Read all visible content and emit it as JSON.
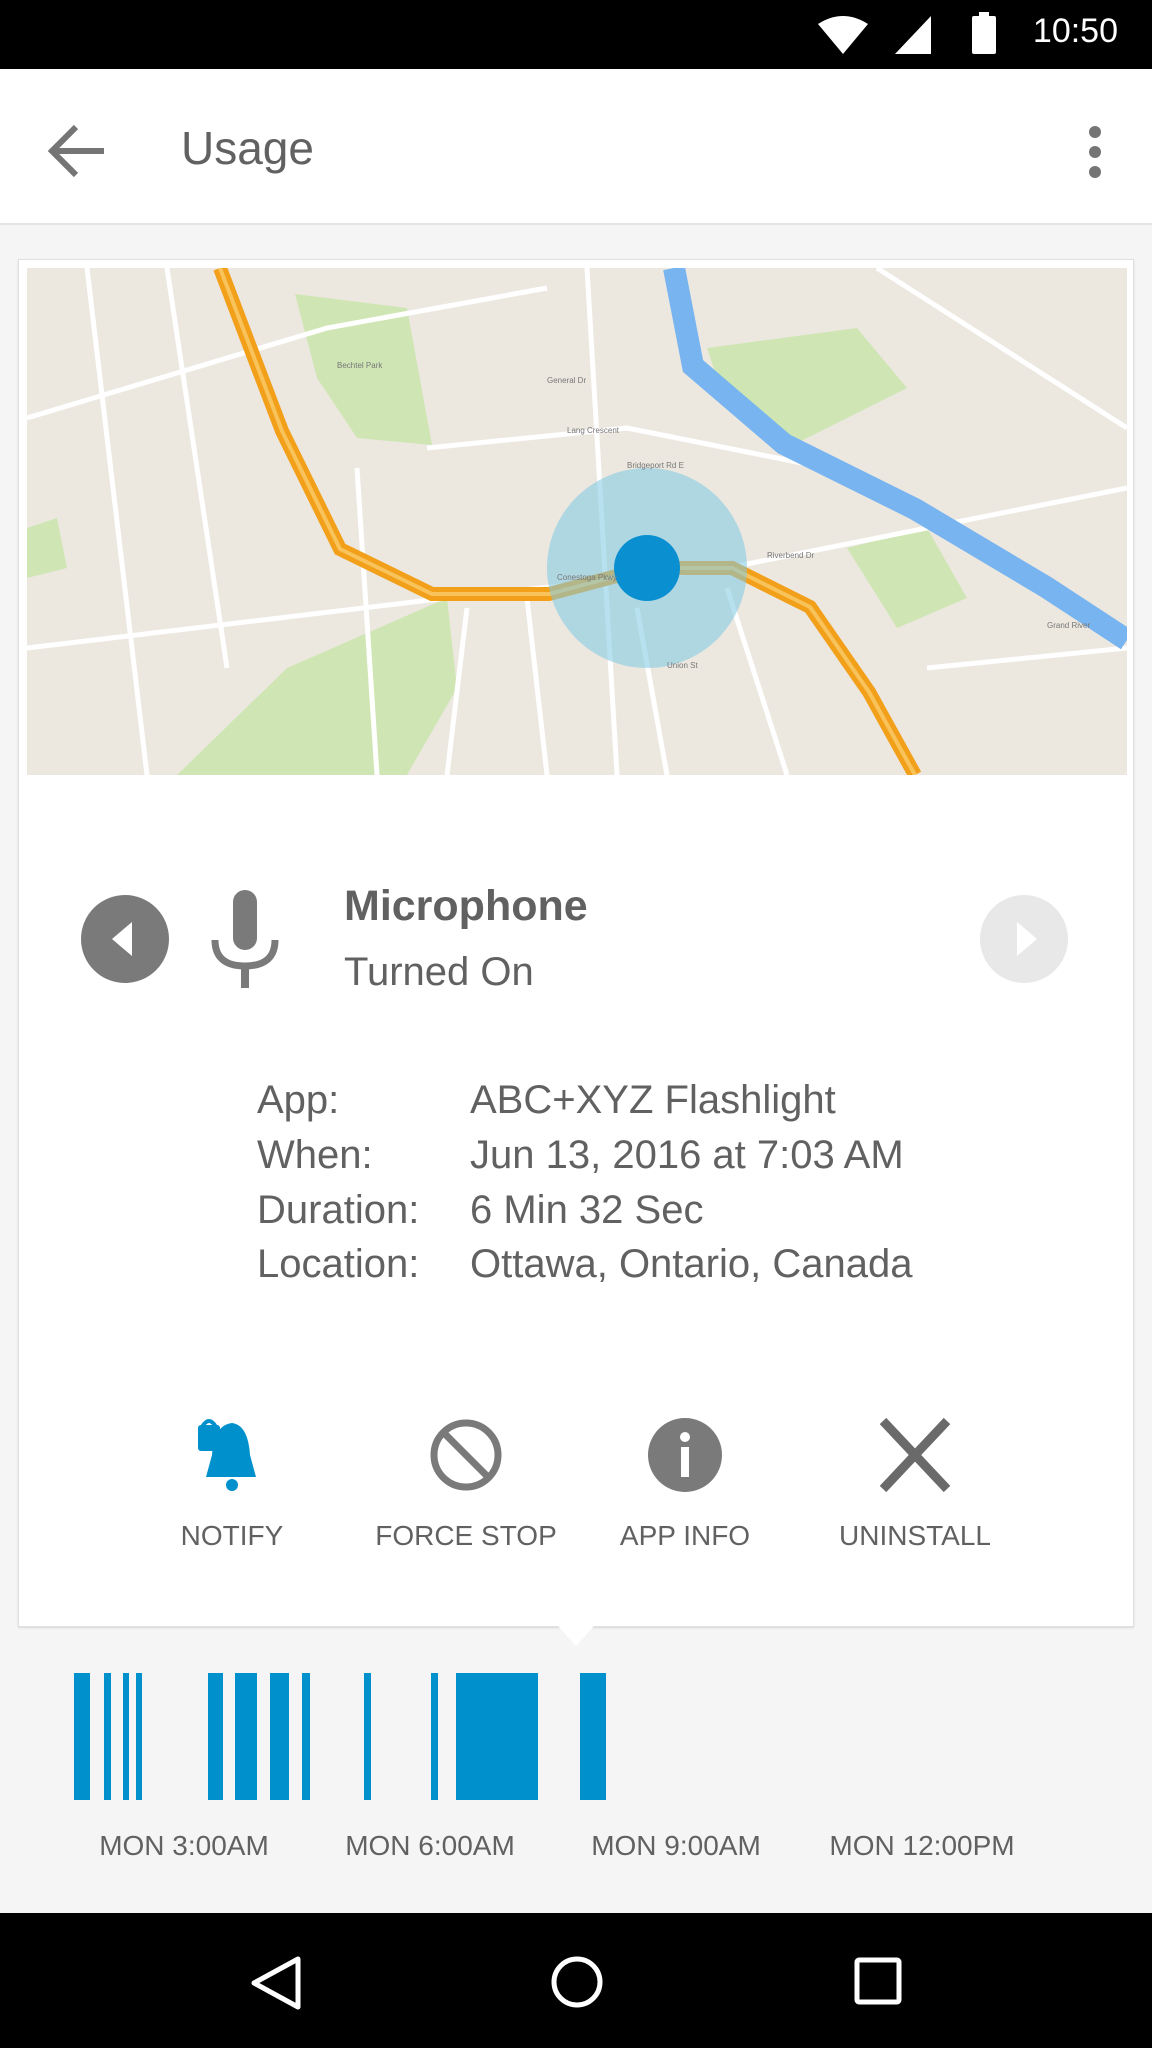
{
  "status_bar": {
    "time": "10:50",
    "icons": [
      "wifi-icon",
      "cell-signal-icon",
      "battery-icon"
    ]
  },
  "app_bar": {
    "title": "Usage",
    "back_icon": "arrow-back-icon",
    "menu_icon": "more-vert-icon"
  },
  "map": {
    "labels": [
      "Bridgeport Rd E",
      "Grand River",
      "Conestoga Pkwy",
      "Union St",
      "Lang Crescent",
      "General Dr",
      "Riverbend Dr",
      "Bechtel Park"
    ]
  },
  "permission": {
    "name": "Microphone",
    "state": "Turned On",
    "icon": "microphone-icon"
  },
  "details": [
    {
      "label": "App:",
      "value": "ABC+XYZ Flashlight"
    },
    {
      "label": "When:",
      "value": "Jun 13, 2016 at 7:03 AM"
    },
    {
      "label": "Duration:",
      "value": "6 Min 32 Sec"
    },
    {
      "label": "Location:",
      "value": "Ottawa, Ontario, Canada"
    }
  ],
  "actions": [
    {
      "label": "NOTIFY",
      "icon": "notification-bell-lock-icon"
    },
    {
      "label": "FORCE STOP",
      "icon": "block-icon"
    },
    {
      "label": "APP INFO",
      "icon": "info-icon"
    },
    {
      "label": "UNINSTALL",
      "icon": "close-icon"
    }
  ],
  "colors": {
    "accent": "#0091cd",
    "icon_gray": "#7a7a7a",
    "disabled": "#e6e6e6"
  },
  "timeline": {
    "labels": [
      {
        "text": "MON  3:00AM",
        "hour": 3
      },
      {
        "text": "MON  6:00AM",
        "hour": 6
      },
      {
        "text": "MON  9:00AM",
        "hour": 9
      },
      {
        "text": "MON  12:00PM",
        "hour": 12
      }
    ],
    "events_hours": [
      [
        1.66,
        1.85
      ],
      [
        2.02,
        2.11
      ],
      [
        2.26,
        2.33
      ],
      [
        2.41,
        2.49
      ],
      [
        3.29,
        3.48
      ],
      [
        3.62,
        3.89
      ],
      [
        4.05,
        4.28
      ],
      [
        4.44,
        4.54
      ],
      [
        5.2,
        5.28
      ],
      [
        6.01,
        6.1
      ],
      [
        6.32,
        7.32
      ],
      [
        7.83,
        8.15
      ]
    ]
  }
}
